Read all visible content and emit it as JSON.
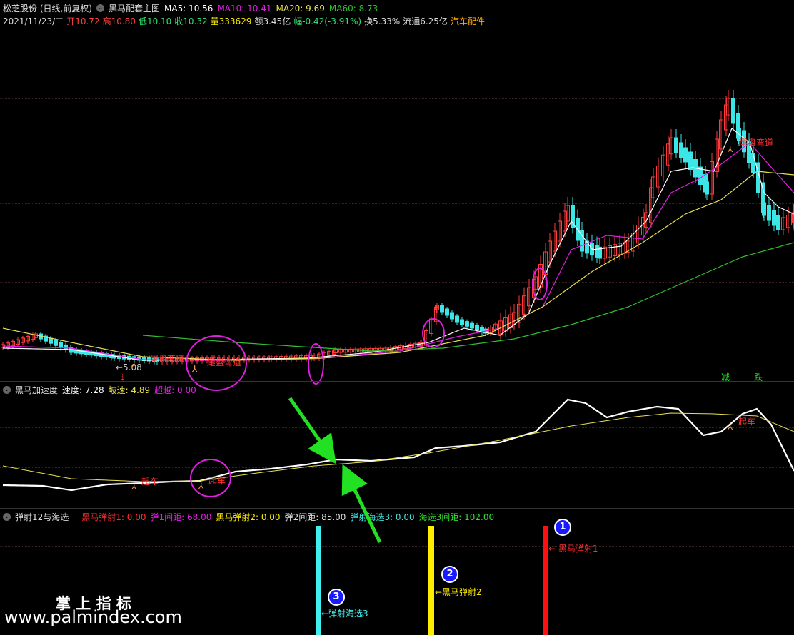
{
  "main_header": {
    "stock": "松芝股份 (日线,前复权)",
    "indicator": "黑马配套主图",
    "ma5_label": "MA5: 10.56",
    "ma10_label": "MA10: 10.41",
    "ma20_label": "MA20: 9.69",
    "ma60_label": "MA60: 8.73"
  },
  "quote_line": {
    "date": "2021/11/23/二",
    "open": "开10.72",
    "high": "高10.80",
    "low": "低10.10",
    "close": "收10.32",
    "volume": "量333629",
    "amount": "额3.45亿",
    "change": "幅-0.42(-3.91%)",
    "turnover": "换5.33%",
    "float": "流通6.25亿",
    "sector": "汽车配件"
  },
  "main_annotations": {
    "low_price": "←5.08",
    "buy_mark": "$",
    "signal_1": "尾盘弯道",
    "signal_2": "尾盘弯道",
    "signal_3": "尾盘弯道",
    "reduce": "减",
    "drop": "跌"
  },
  "accel_header": {
    "title": "黑马加速度",
    "speed": "速度: 7.28",
    "slope": "坡速: 4.89",
    "exceed": "超越: 0.00"
  },
  "accel_annotations": {
    "board_1": "起车",
    "board_2": "起车",
    "board_3": "起车"
  },
  "eject_header": {
    "title": "弹射12与海选",
    "h1": "黑马弹射1: 0.00",
    "h2": "弹1间距: 68.00",
    "h3": "黑马弹射2: 0.00",
    "h4": "弹2间距: 85.00",
    "h5": "弹射海选3: 0.00",
    "h6": "海选3间距: 102.00"
  },
  "eject_annotations": {
    "badge_1": "1",
    "badge_2": "2",
    "badge_3": "3",
    "label_1": "← 黑马弹射1",
    "label_2": "←黑马弹射2",
    "label_3": "←弹射海选3"
  },
  "watermark": {
    "cn": "掌 上 指 标",
    "url": "www.palmindex.com"
  },
  "colors": {
    "up": "#ff3b3b",
    "down": "#3ce6e6",
    "ma5": "#ffffff",
    "ma10": "#e020e0",
    "ma20": "#e8e050",
    "ma60": "#30c030",
    "eject1": "#ff1010",
    "eject2": "#ffee00",
    "eject3": "#40f0f0",
    "arrow": "#22e022"
  }
}
